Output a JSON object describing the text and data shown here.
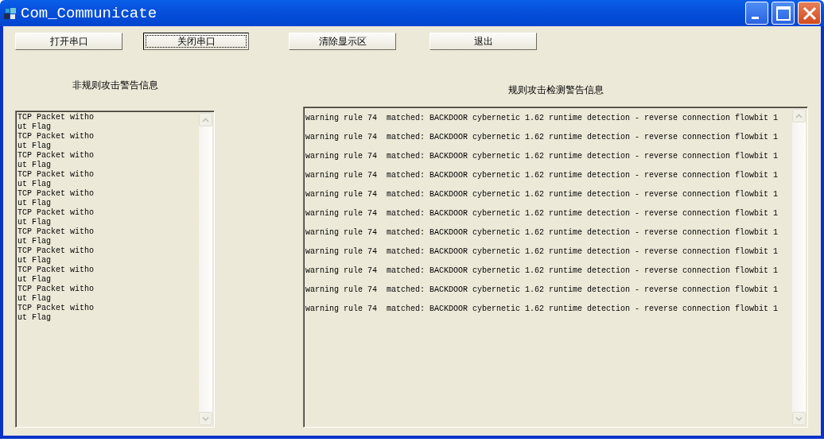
{
  "window": {
    "title": "Com_Communicate"
  },
  "buttons": [
    {
      "label": "打开串口",
      "focused": false
    },
    {
      "label": "关闭串口",
      "focused": true
    },
    {
      "label": "清除显示区",
      "focused": false
    },
    {
      "label": "退出",
      "focused": false
    }
  ],
  "left_panel": {
    "title": "非规则攻击警告信息",
    "lines": [
      "TCP Packet witho",
      "ut Flag",
      "TCP Packet witho",
      "ut Flag",
      "TCP Packet witho",
      "ut Flag",
      "TCP Packet witho",
      "ut Flag",
      "TCP Packet witho",
      "ut Flag",
      "TCP Packet witho",
      "ut Flag",
      "TCP Packet witho",
      "ut Flag",
      "TCP Packet witho",
      "ut Flag",
      "TCP Packet witho",
      "ut Flag",
      "TCP Packet witho",
      "ut Flag",
      "TCP Packet witho",
      "ut Flag"
    ]
  },
  "right_panel": {
    "title": "规则攻击检测警告信息",
    "lines": [
      "warning rule 74  matched: BACKDOOR cybernetic 1.62 runtime detection - reverse connection flowbit 1",
      "warning rule 74  matched: BACKDOOR cybernetic 1.62 runtime detection - reverse connection flowbit 1",
      "warning rule 74  matched: BACKDOOR cybernetic 1.62 runtime detection - reverse connection flowbit 1",
      "warning rule 74  matched: BACKDOOR cybernetic 1.62 runtime detection - reverse connection flowbit 1",
      "warning rule 74  matched: BACKDOOR cybernetic 1.62 runtime detection - reverse connection flowbit 1",
      "warning rule 74  matched: BACKDOOR cybernetic 1.62 runtime detection - reverse connection flowbit 1",
      "warning rule 74  matched: BACKDOOR cybernetic 1.62 runtime detection - reverse connection flowbit 1",
      "warning rule 74  matched: BACKDOOR cybernetic 1.62 runtime detection - reverse connection flowbit 1",
      "warning rule 74  matched: BACKDOOR cybernetic 1.62 runtime detection - reverse connection flowbit 1",
      "warning rule 74  matched: BACKDOOR cybernetic 1.62 runtime detection - reverse connection flowbit 1",
      "warning rule 74  matched: BACKDOOR cybernetic 1.62 runtime detection - reverse connection flowbit 1"
    ]
  }
}
